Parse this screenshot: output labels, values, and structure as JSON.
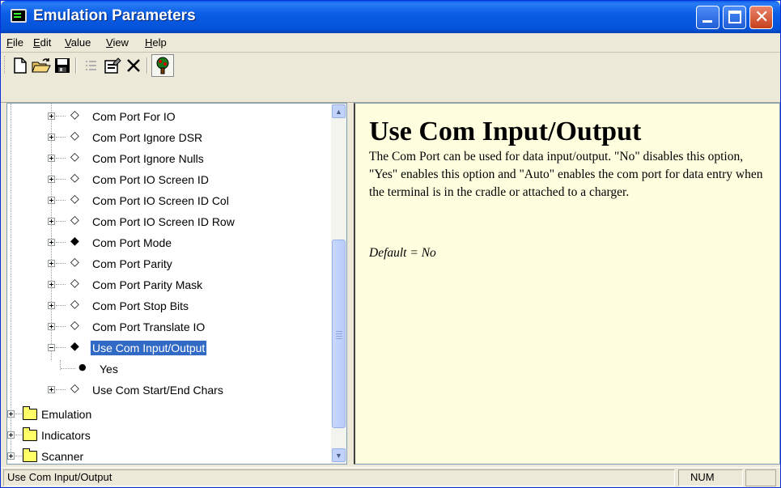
{
  "window": {
    "title": "Emulation Parameters"
  },
  "menu": {
    "items": [
      {
        "label": "File",
        "accel": "F",
        "rest": "ile"
      },
      {
        "label": "Edit",
        "accel": "E",
        "rest": "dit"
      },
      {
        "label": "Value",
        "accel": "V",
        "rest": "alue"
      },
      {
        "label": "View",
        "accel": "V",
        "rest": "iew"
      },
      {
        "label": "Help",
        "accel": "H",
        "rest": "elp"
      }
    ]
  },
  "toolbar": {
    "icons": [
      "new-document-icon",
      "open-folder-icon",
      "save-icon",
      "list-icon",
      "properties-icon",
      "delete-icon",
      "tree-icon"
    ]
  },
  "tree": {
    "items": [
      {
        "label": "Com Port For IO",
        "marker": "◇"
      },
      {
        "label": "Com Port Ignore DSR",
        "marker": "◇"
      },
      {
        "label": "Com Port Ignore Nulls",
        "marker": "◇"
      },
      {
        "label": "Com Port IO Screen ID",
        "marker": "◇"
      },
      {
        "label": "Com Port IO Screen ID Col",
        "marker": "◇"
      },
      {
        "label": "Com Port IO Screen ID Row",
        "marker": "◇"
      },
      {
        "label": "Com Port Mode",
        "marker": "◆"
      },
      {
        "label": "Com Port Parity",
        "marker": "◇"
      },
      {
        "label": "Com Port Parity Mask",
        "marker": "◇"
      },
      {
        "label": "Com Port Stop Bits",
        "marker": "◇"
      },
      {
        "label": "Com Port Translate IO",
        "marker": "◇"
      },
      {
        "label": "Use Com Input/Output",
        "marker": "◆"
      },
      {
        "label": "Yes",
        "marker": "●"
      },
      {
        "label": "Use Com Start/End Chars",
        "marker": "◇"
      }
    ],
    "folders": [
      "Emulation",
      "Indicators",
      "Scanner"
    ],
    "selected": "Use Com Input/Output"
  },
  "content": {
    "title": "Use Com Input/Output",
    "body": "The Com Port can be used for data input/output.  \"No\" disables this option,   \"Yes\" enables this option and \"Auto\" enables the com port for data  entry when the terminal is in the cradle or attached to a charger.",
    "default_text": "Default = No",
    "background": "#ffffe0"
  },
  "status": {
    "text": "Use Com Input/Output",
    "num": "NUM"
  },
  "colors": {
    "titlebar": "#0452d8",
    "selection": "#316ac5",
    "folder": "#ffff66"
  }
}
